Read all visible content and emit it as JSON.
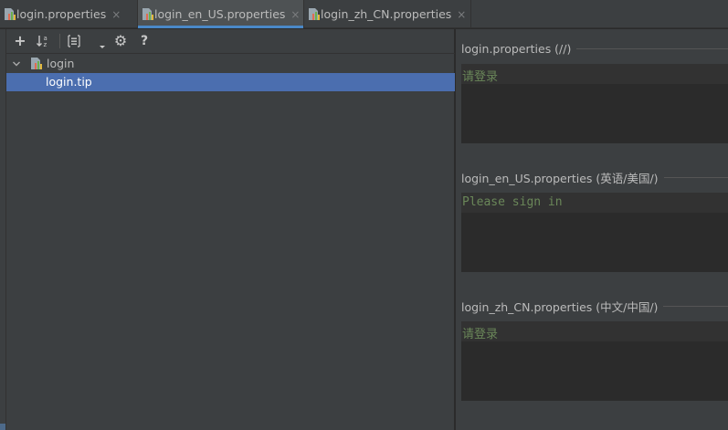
{
  "tabs": [
    {
      "label": "login.properties",
      "close": "×",
      "active": false
    },
    {
      "label": "login_en_US.properties",
      "close": "×",
      "active": true
    },
    {
      "label": "login_zh_CN.properties",
      "close": "×",
      "active": false
    }
  ],
  "toolbar": {
    "add": "+",
    "sort": "↓a z",
    "settings": "⚙",
    "help": "?"
  },
  "tree": {
    "root_label": "login",
    "selected_label": "login.tip"
  },
  "sections": [
    {
      "title": "login.properties (//)",
      "value": "请登录"
    },
    {
      "title": "login_en_US.properties (英语/美国/)",
      "value": "Please sign in"
    },
    {
      "title": "login_zh_CN.properties (中文/中国/)",
      "value": "请登录"
    }
  ],
  "colors": {
    "accent": "#4a88c7",
    "selection": "#4b6eaf",
    "string_value": "#6a8759"
  }
}
